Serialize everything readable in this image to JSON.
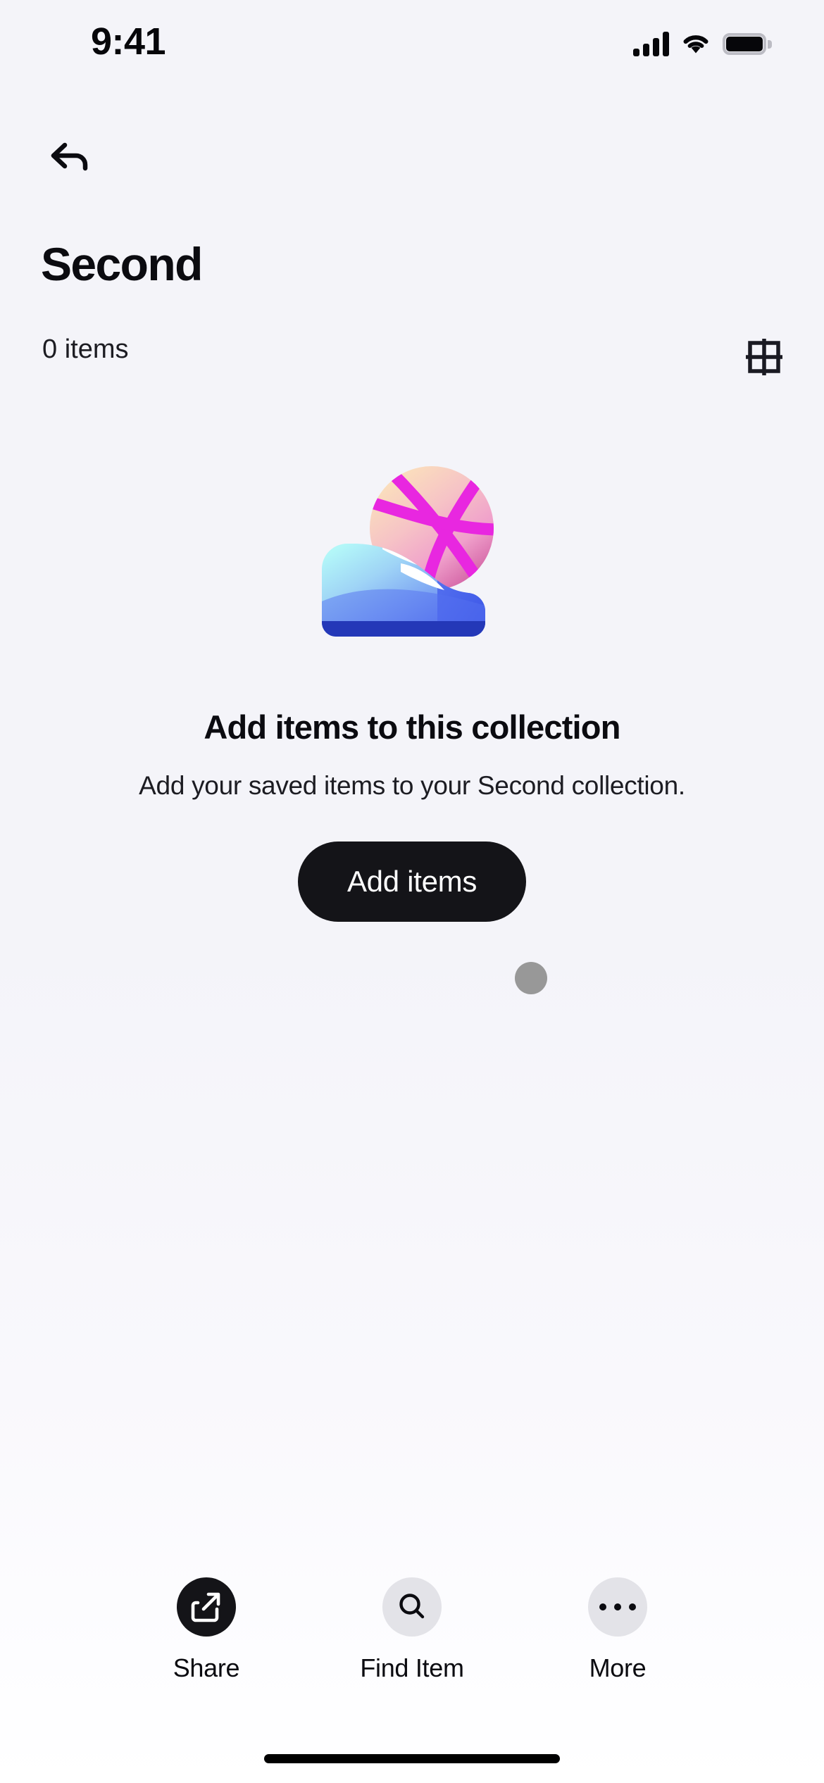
{
  "status_bar": {
    "time": "9:41",
    "signal_icon": "cellular-signal-icon",
    "wifi_icon": "wifi-icon",
    "battery_icon": "battery-full-icon"
  },
  "nav": {
    "back_icon": "back-arrow-icon"
  },
  "header": {
    "title": "Second",
    "item_count": "0 items",
    "grid_view_icon": "grid-view-icon"
  },
  "empty_state": {
    "illustration_name": "sneaker-and-basketball-illustration",
    "title": "Add items to this collection",
    "subtitle": "Add your saved items to your Second collection.",
    "button_label": "Add items",
    "cursor_indicator": "touch-cursor-dot"
  },
  "bottom_bar": {
    "actions": [
      {
        "label": "Share",
        "icon": "share-icon",
        "style": "dark"
      },
      {
        "label": "Find Item",
        "icon": "search-icon",
        "style": "light"
      },
      {
        "label": "More",
        "icon": "more-ellipsis-icon",
        "style": "light"
      }
    ]
  },
  "system": {
    "home_indicator": "home-indicator"
  },
  "colors": {
    "background_top": "#f4f4f9",
    "background_bottom": "#ffffff",
    "text_primary": "#0b0b10",
    "button_dark": "#141418",
    "circle_light": "#e3e3e8",
    "cursor_grey": "#989898",
    "ball_highlight": "#fbe0b8",
    "ball_mid": "#f3aec6",
    "ball_shadow": "#d25a9e",
    "ball_lines": "#e827e0",
    "shoe_light": "#a9f5f5",
    "shoe_mid": "#7fa8f7",
    "shoe_dark": "#3f5fe8",
    "shoe_sole": "#2438b8"
  }
}
